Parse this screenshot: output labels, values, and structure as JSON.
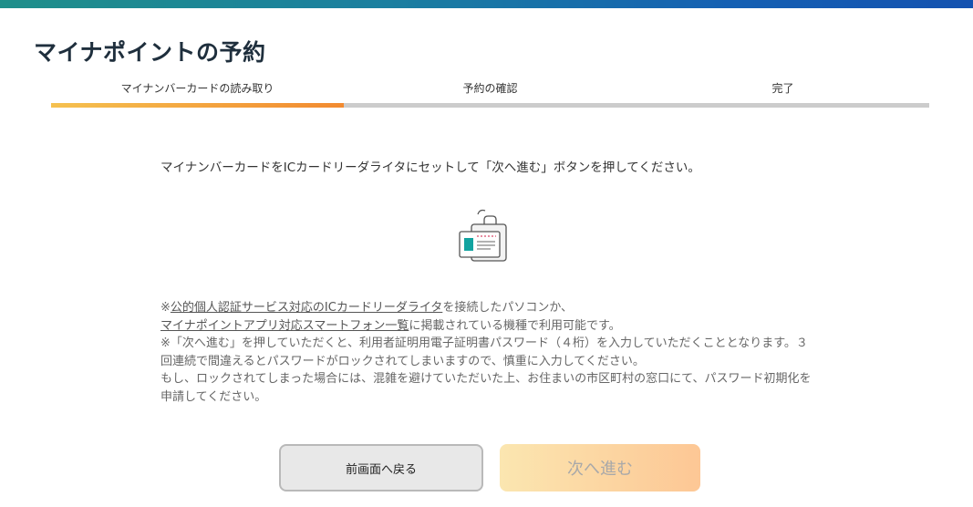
{
  "header": {
    "title": "マイナポイントの予約"
  },
  "steps": [
    {
      "label": "マイナンバーカードの読み取り",
      "state": "active"
    },
    {
      "label": "予約の確認",
      "state": "pending"
    },
    {
      "label": "完了",
      "state": "pending"
    }
  ],
  "main": {
    "instruction": "マイナンバーカードをICカードリーダライタにセットして「次へ進む」ボタンを押してください。",
    "notes": {
      "prefix": "※",
      "link1": "公的個人認証サービス対応のICカードリーダライタ",
      "line1_suffix": "を接続したパソコンか、",
      "link2": "マイナポイントアプリ対応スマートフォン一覧",
      "line2_suffix": "に掲載されている機種で利用可能です。",
      "warning": "※「次へ進む」を押していただくと、利用者証明用電子証明書パスワード（４桁）を入力していただくこととなります。３回連続で間違えるとパスワードがロックされてしまいますので、慎重に入力してください。",
      "lock_note": "もし、ロックされてしまった場合には、混雑を避けていただいた上、お住まいの市区町村の窓口にて、パスワード初期化を申請してください。"
    }
  },
  "buttons": {
    "back_label": "前画面へ戻る",
    "next_label": "次へ進む"
  },
  "icons": {
    "reader": "card-reader-icon"
  },
  "colors": {
    "accent_gradient_start": "#f5c150",
    "accent_gradient_end": "#f28a30",
    "top_bar": "#1b7fa0",
    "card_teal": "#12a3a0"
  }
}
